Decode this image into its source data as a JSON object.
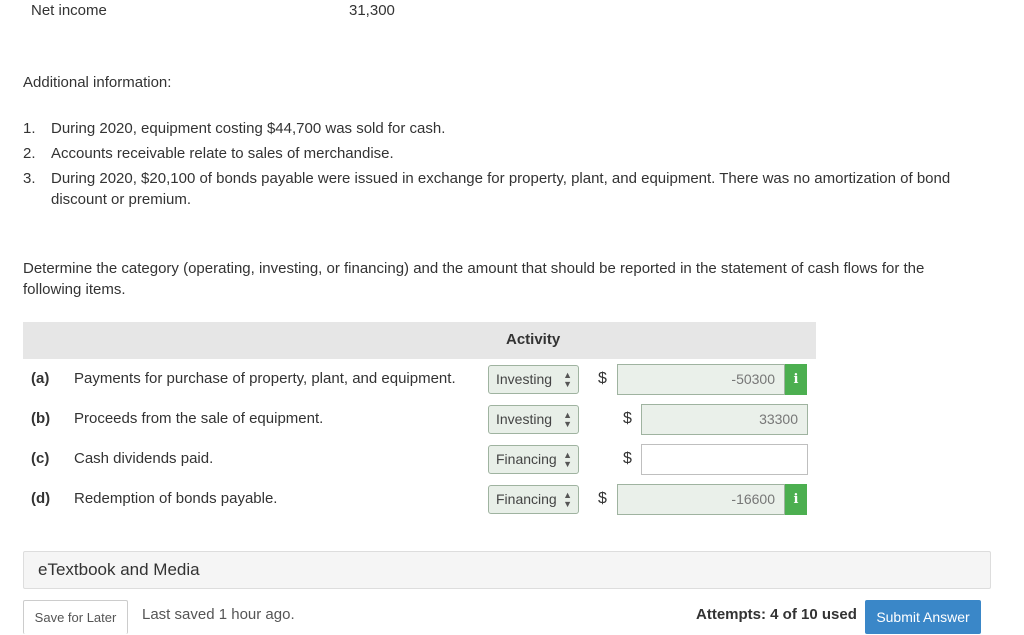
{
  "income": {
    "label": "Net income",
    "value": "31,300"
  },
  "additional_info": {
    "heading": "Additional information:",
    "items": [
      {
        "num": "1.",
        "text": "During 2020, equipment costing $44,700 was sold for cash."
      },
      {
        "num": "2.",
        "text": "Accounts receivable relate to sales of merchandise."
      },
      {
        "num": "3.",
        "text": "During 2020, $20,100 of bonds payable were issued in exchange for property, plant, and equipment. There was no amortization of bond discount or premium."
      }
    ]
  },
  "question": "Determine the category (operating, investing, or financing) and the amount that should be reported in the statement of cash flows for the following items.",
  "table": {
    "column_header": "Activity",
    "rows": [
      {
        "letter": "(a)",
        "text": "Payments for purchase of property, plant, and equipment.",
        "activity": "Investing",
        "currency": "$",
        "amount": "-50300",
        "has_info": true
      },
      {
        "letter": "(b)",
        "text": "Proceeds from the sale of equipment.",
        "activity": "Investing",
        "currency": "$",
        "amount": "33300",
        "has_info": false
      },
      {
        "letter": "(c)",
        "text": "Cash dividends paid.",
        "activity": "Financing",
        "currency": "$",
        "amount": "",
        "has_info": false
      },
      {
        "letter": "(d)",
        "text": "Redemption of bonds payable.",
        "activity": "Financing",
        "currency": "$",
        "amount": "-16600",
        "has_info": true
      }
    ]
  },
  "etextbook": {
    "label": "eTextbook and Media"
  },
  "footer": {
    "save_label": "Save for Later",
    "last_saved": "Last saved 1 hour ago.",
    "attempts": "Attempts: 4 of 10 used",
    "submit_label": "Submit Answer"
  },
  "icons": {
    "info": "info-icon",
    "select_arrows": "sort-arrows-icon"
  },
  "colors": {
    "accent": "#3a87c8",
    "correct": "#4caf50",
    "table_header": "#e6e6e6"
  }
}
